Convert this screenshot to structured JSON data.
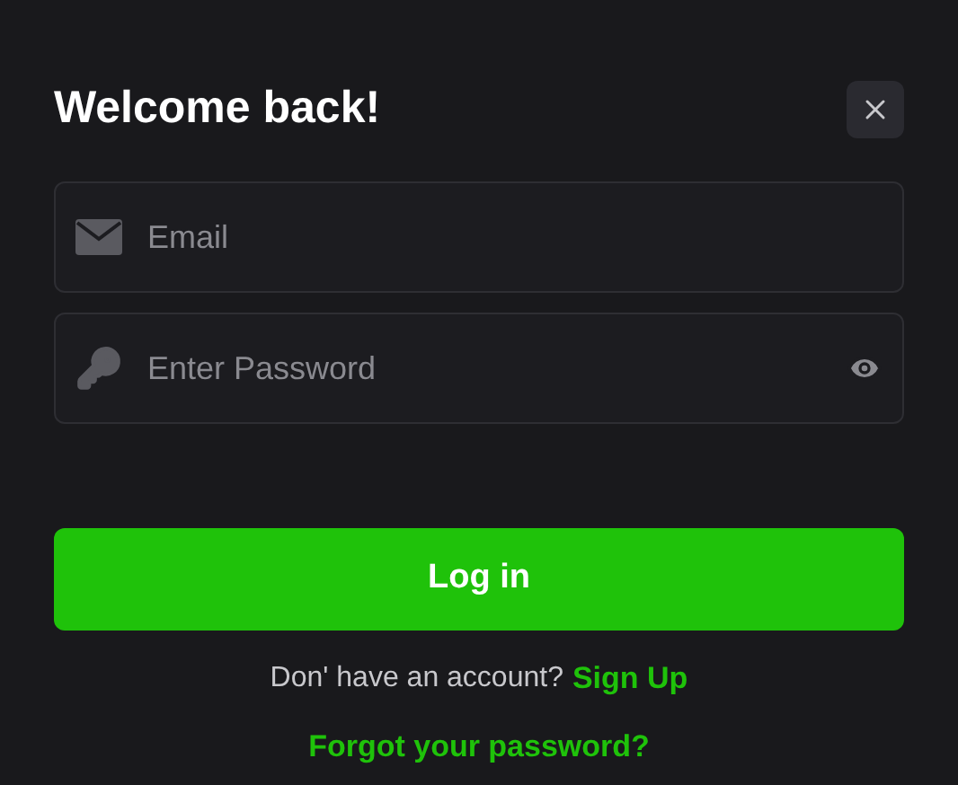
{
  "title": "Welcome back!",
  "fields": [
    {
      "kind": "email",
      "placeholder": "Email"
    },
    {
      "kind": "password",
      "placeholder": "Enter Password"
    }
  ],
  "login_button": "Log in",
  "signup_prompt": {
    "text": "Don' have an account?",
    "link": "Sign Up"
  },
  "forgot_link": "Forgot your password?"
}
